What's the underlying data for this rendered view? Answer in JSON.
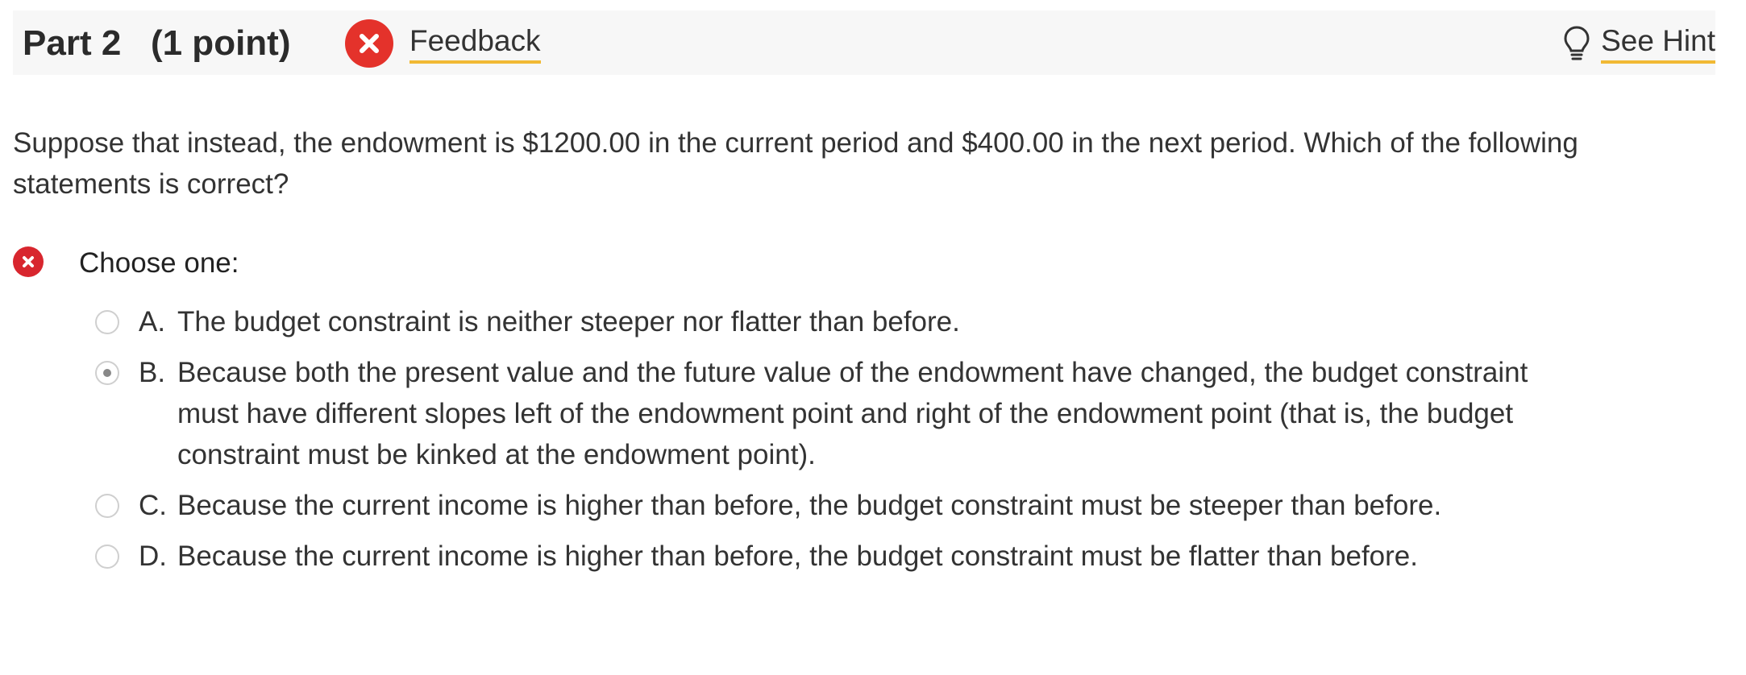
{
  "header": {
    "part_title": "Part 2   (1 point)",
    "feedback_label": "Feedback",
    "hint_label": "See Hint"
  },
  "question": {
    "text": "Suppose that instead, the endowment is $1200.00 in the current period and $400.00 in the next period.  Which of the following statements is correct?",
    "status": "incorrect",
    "choose_label": "Choose one:"
  },
  "options": [
    {
      "letter": "A.",
      "text": "The budget constraint is neither steeper nor flatter than before.",
      "selected": false
    },
    {
      "letter": "B.",
      "text": "Because both the present value and the future value of the endowment have changed, the budget constraint must have different slopes left of the endowment point and right of the endowment point (that is, the budget constraint must be kinked at the endowment point).",
      "selected": true
    },
    {
      "letter": "C.",
      "text": "Because the current income is higher than before, the budget constraint must be steeper than before.",
      "selected": false
    },
    {
      "letter": "D.",
      "text": "Because the current income is higher than before, the budget constraint must be flatter than before.",
      "selected": false
    }
  ],
  "icons": {
    "feedback": "x-circle-icon",
    "hint": "lightbulb-icon",
    "answer_status": "x-circle-icon"
  },
  "colors": {
    "error_red": "#e4322b",
    "link_underline": "#f1b934",
    "header_bg": "#f7f7f7"
  }
}
